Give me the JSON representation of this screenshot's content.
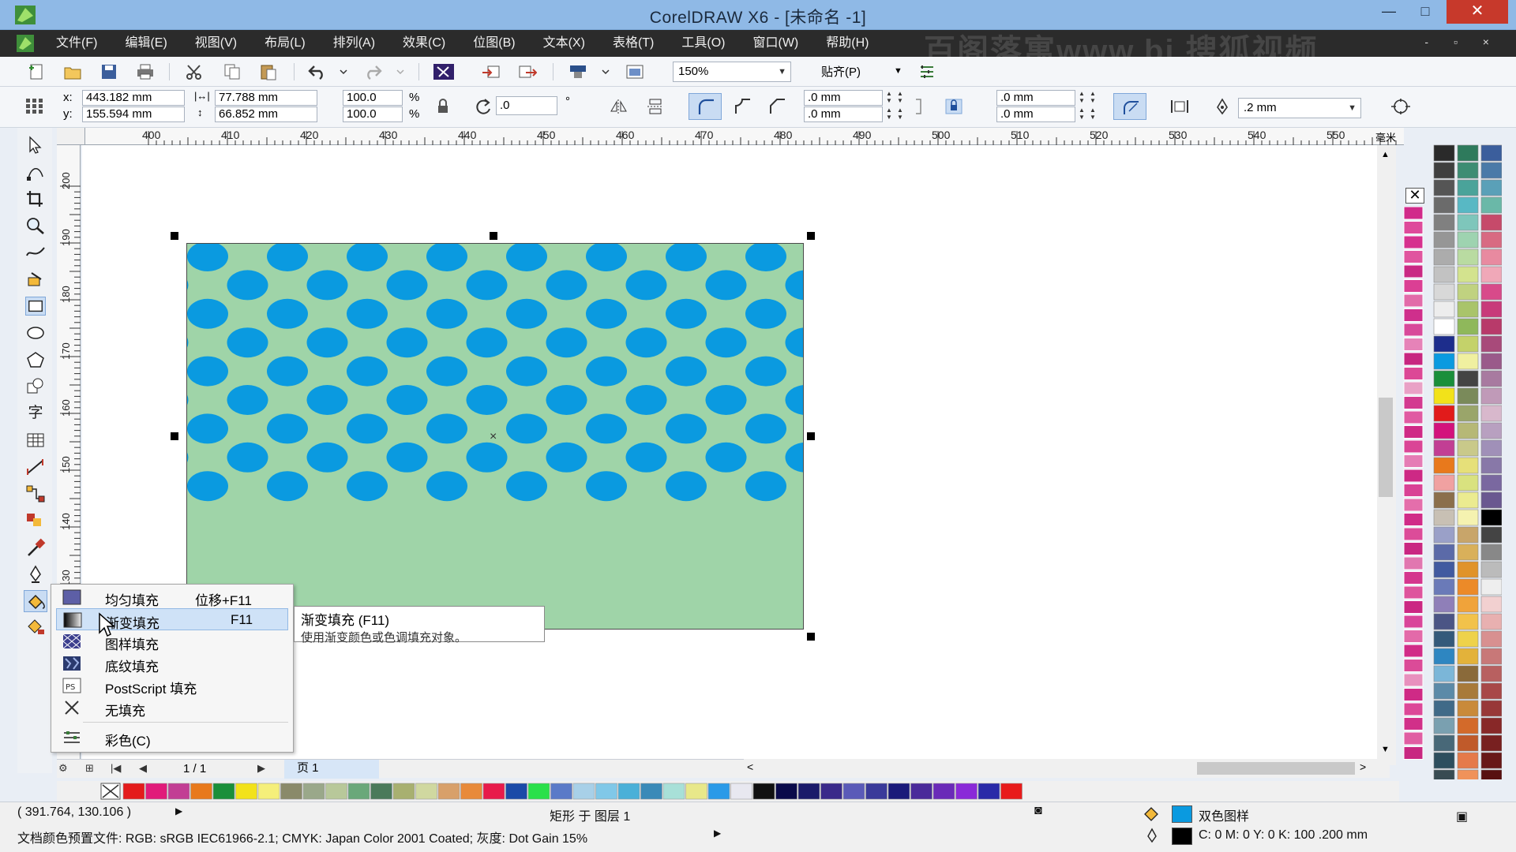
{
  "window": {
    "title": "CorelDRAW X6 - [未命名 -1]",
    "minimize": "—",
    "maximize": "□",
    "close": "✕"
  },
  "menu": {
    "items": [
      "文件(F)",
      "编辑(E)",
      "视图(V)",
      "布局(L)",
      "排列(A)",
      "效果(C)",
      "位图(B)",
      "文本(X)",
      "表格(T)",
      "工具(O)",
      "窗口(W)",
      "帮助(H)"
    ],
    "mdi_controls": "- ▫ ×"
  },
  "toolbar": {
    "zoom": "150%",
    "snap_label": "贴齐(P)"
  },
  "property_bar": {
    "x_label": "x:",
    "x_value": "443.182 mm",
    "y_label": "y:",
    "y_value": "155.594 mm",
    "width_value": "77.788 mm",
    "height_value": "66.852 mm",
    "scale_x": "100.0",
    "scale_y": "100.0",
    "percent": "%",
    "rotation": ".0",
    "degree": "°",
    "corner_1": ".0 mm",
    "corner_2": ".0 mm",
    "corner_3": ".0 mm",
    "corner_4": ".0 mm",
    "outline_width": ".2 mm"
  },
  "rulers": {
    "horizontal": [
      "400",
      "410",
      "420",
      "430",
      "440",
      "450",
      "460",
      "470",
      "480",
      "490",
      "500",
      "510",
      "520",
      "530",
      "540",
      "550"
    ],
    "vertical": [
      "200",
      "190",
      "180",
      "170",
      "160",
      "150",
      "140",
      "130"
    ],
    "unit": "毫米"
  },
  "flyout_menu": {
    "items": [
      {
        "label": "均匀填充",
        "shortcut": "位移+F11"
      },
      {
        "label": "渐变填充",
        "shortcut": "F11"
      },
      {
        "label": "图样填充",
        "shortcut": ""
      },
      {
        "label": "底纹填充",
        "shortcut": ""
      },
      {
        "label": "PostScript 填充",
        "shortcut": ""
      },
      {
        "label": "无填充",
        "shortcut": ""
      },
      {
        "label": "彩色(C)",
        "shortcut": ""
      }
    ],
    "highlighted_index": 1
  },
  "tooltip": {
    "title": "渐变填充 (F11)",
    "description": "使用渐变颜色或色调填充对象。"
  },
  "page_nav": {
    "count": "1 / 1",
    "page_tab": "页 1"
  },
  "status": {
    "cursor_coords": "( 391.764, 130.106 )",
    "object_info": "矩形 于 图层 1",
    "fill_info": "双色图样",
    "outline_info": "C: 0 M: 0 Y: 0 K: 100  .200 mm",
    "color_profile": "文档颜色预置文件: RGB: sRGB IEC61966-2.1; CMYK: Japan Color 2001 Coated; 灰度: Dot Gain 15%"
  },
  "colors": {
    "pattern_bg": "#9fd4a8",
    "pattern_dot": "#0a9ae0",
    "menubar_bg": "#2b2b2b",
    "titlebar_bg": "#8fb9e6",
    "highlight": "#cfe2f7"
  },
  "watermark_text": "百阁落寓www.bi    搜狐视频"
}
